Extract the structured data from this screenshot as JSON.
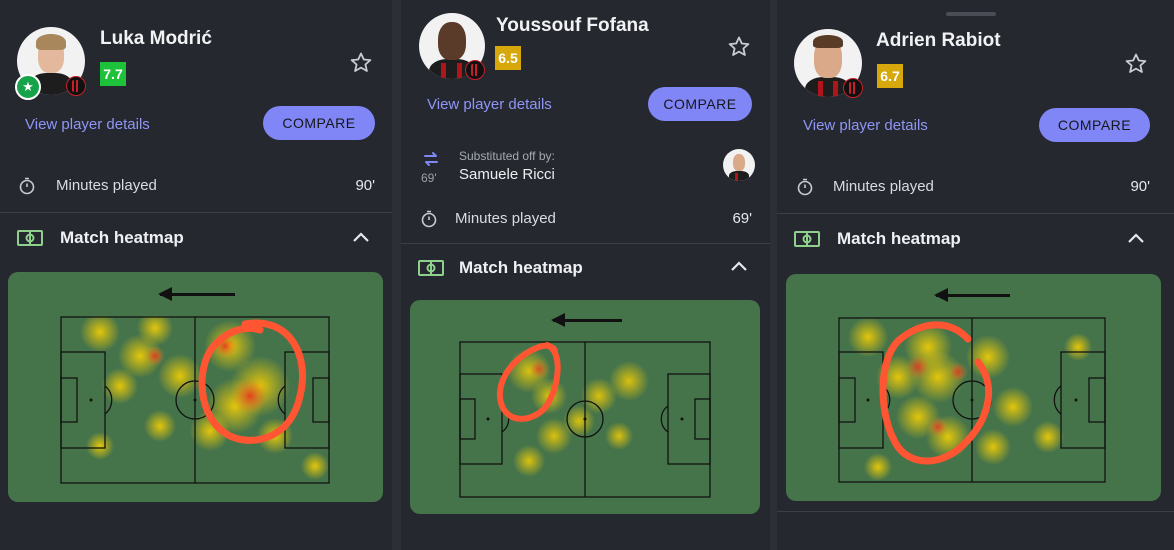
{
  "players": [
    {
      "name": "Luka Modrić",
      "rating": "7.7",
      "rating_color": "#1ec23a",
      "details_link": "View player details",
      "compare_label": "COMPARE",
      "minutes_label": "Minutes played",
      "minutes_value": "90'",
      "heatmap_title": "Match heatmap",
      "badge_icon": "star-badge-icon"
    },
    {
      "name": "Youssouf Fofana",
      "rating": "6.5",
      "rating_color": "#d6a80c",
      "details_link": "View player details",
      "compare_label": "COMPARE",
      "substitution": {
        "minute": "69'",
        "caption": "Substituted off by:",
        "replacement": "Samuele Ricci"
      },
      "minutes_label": "Minutes played",
      "minutes_value": "69'",
      "heatmap_title": "Match heatmap"
    },
    {
      "name": "Adrien Rabiot",
      "rating": "6.7",
      "rating_color": "#d6a80c",
      "details_link": "View player details",
      "compare_label": "COMPARE",
      "minutes_label": "Minutes played",
      "minutes_value": "90'",
      "heatmap_title": "Match heatmap"
    }
  ],
  "colors": {
    "accent": "#8086f5",
    "link": "#8f96f5",
    "pitch_green": "#46744a",
    "annotation": "#ff5533"
  },
  "icons": [
    "star-outline-icon",
    "stopwatch-icon",
    "pitch-icon",
    "chevron-up-icon",
    "substitution-icon",
    "left-arrow-icon"
  ]
}
